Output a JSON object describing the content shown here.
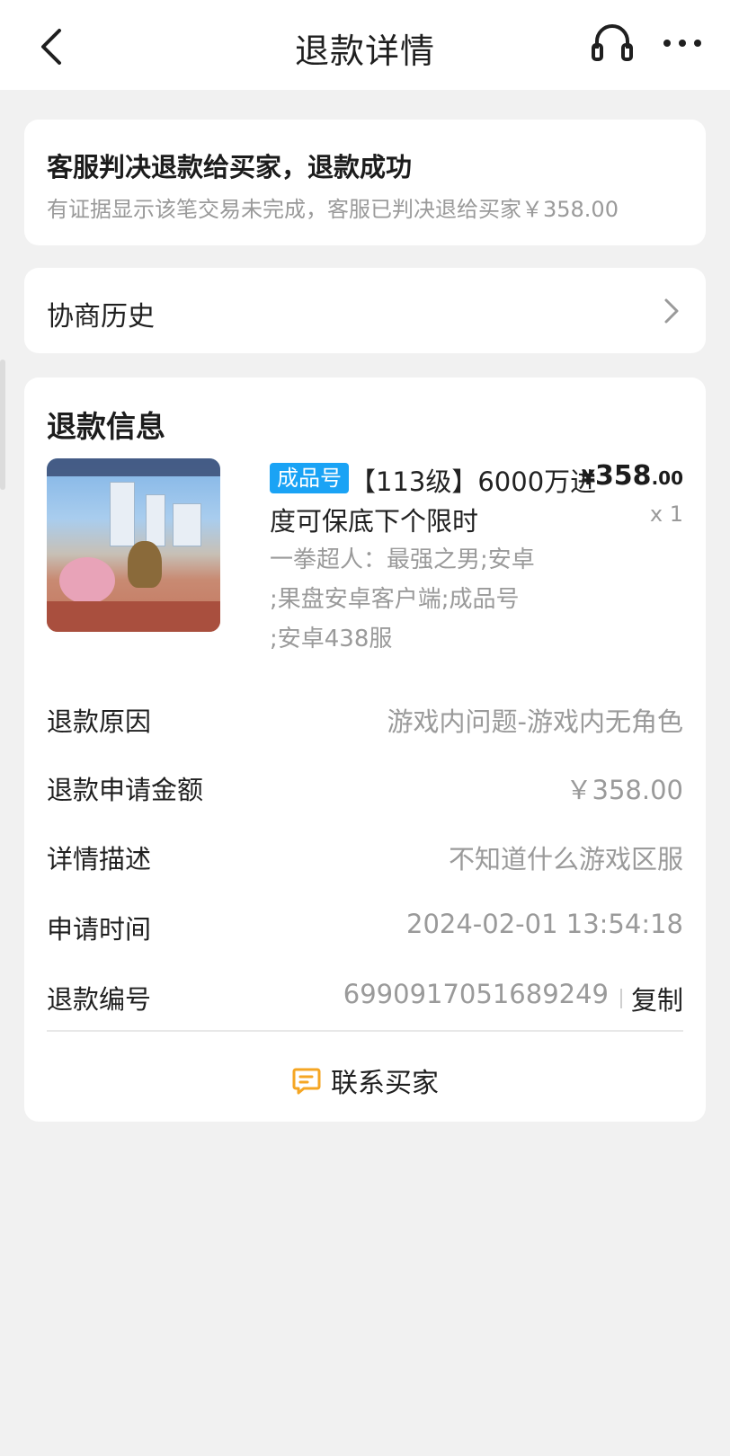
{
  "nav": {
    "title": "退款详情"
  },
  "status": {
    "title": "客服判决退款给买家，退款成功",
    "description": "有证据显示该笔交易未完成，客服已判决退给买家￥358.00"
  },
  "history": {
    "label": "协商历史"
  },
  "refund_info": {
    "title": "退款信息",
    "product": {
      "tag": "成品号",
      "name_line1": "【113级】6000万进",
      "name_line2": "度可保底下个限时",
      "detail_line1": "一拳超人：最强之男;安卓",
      "detail_line2": ";果盘安卓客户端;成品号",
      "detail_line3": ";安卓438服",
      "price_symbol": "¥",
      "price_integer": "358",
      "price_decimal": ".00",
      "quantity": "x 1"
    },
    "rows": [
      {
        "label": "退款原因",
        "value": "游戏内问题-游戏内无角色"
      },
      {
        "label": "退款申请金额",
        "value": "￥358.00"
      },
      {
        "label": "详情描述",
        "value": "不知道什么游戏区服"
      },
      {
        "label": "申请时间",
        "value": "2024-02-01 13:54:18"
      },
      {
        "label": "退款编号",
        "value": "6990917051689249"
      }
    ],
    "copy_label": "复制",
    "contact_label": "联系买家"
  },
  "colors": {
    "accent_orange": "#f5a623",
    "tag_blue": "#1aa3f5",
    "background": "#f1f1f1"
  },
  "icons": [
    "back-arrow-icon",
    "headset-icon",
    "more-dots-icon",
    "chevron-right-icon",
    "chat-icon"
  ]
}
